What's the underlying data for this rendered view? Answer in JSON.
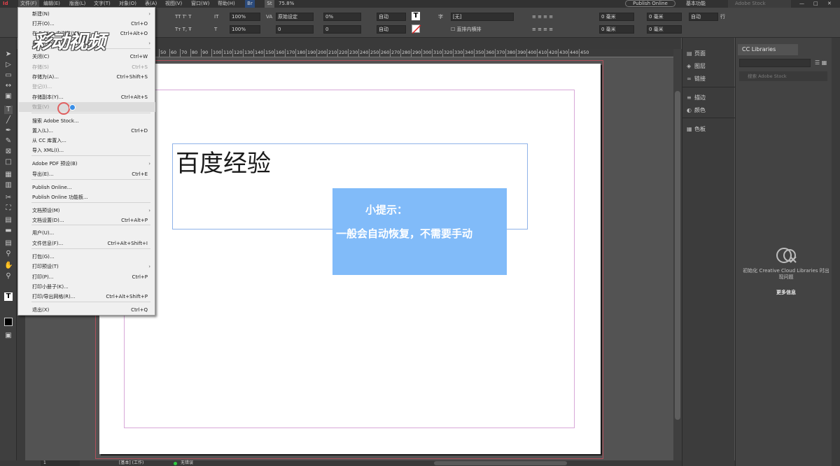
{
  "menubar": {
    "items": [
      "文件(F)",
      "编辑(E)",
      "版面(L)",
      "文字(T)",
      "对象(O)",
      "表(A)",
      "视图(V)",
      "窗口(W)",
      "帮助(H)"
    ],
    "br_badge": "Br",
    "st_badge": "St",
    "zoom": "75.8%",
    "publish_online": "Publish Online",
    "workspace": "基本功能",
    "search_placeholder": "Adobe Stock"
  },
  "controlbar": {
    "scale_h": "100%",
    "scale_v": "100%",
    "kerning": "原始设定",
    "tracking": "0%",
    "baseline": "0",
    "skew": "0",
    "auto1": "自动",
    "auto2": "自动",
    "language": "[无]",
    "no_hyphenation": "直排内横排",
    "space_before": "0 毫米",
    "space_after": "0 毫米",
    "space_before2": "0 毫米",
    "space_after2": "0 毫米",
    "auto3": "自动",
    "row": "行"
  },
  "ruler_ticks": [
    "50",
    "60",
    "70",
    "80",
    "90",
    "100",
    "110",
    "120",
    "130",
    "140",
    "150",
    "160",
    "170",
    "180",
    "190",
    "200",
    "210",
    "220",
    "230",
    "240",
    "250",
    "260",
    "270",
    "280",
    "290",
    "300",
    "310",
    "320",
    "330",
    "340",
    "350",
    "360",
    "370",
    "380",
    "390",
    "400",
    "410",
    "420",
    "430",
    "440",
    "450"
  ],
  "document": {
    "heading": "百度经验",
    "tip_title": "小提示：",
    "tip_body": "一般会自动恢复，不需要手动"
  },
  "watermark": "彩动视频",
  "file_menu": {
    "items": [
      {
        "label": "新建(N)",
        "shortcut": "",
        "submenu": true,
        "disabled": false
      },
      {
        "label": "打开(O)...",
        "shortcut": "Ctrl+O",
        "submenu": false,
        "disabled": false
      },
      {
        "label": "在 Bridge 中浏览(W)...",
        "shortcut": "Ctrl+Alt+O",
        "submenu": false,
        "disabled": false
      },
      {
        "label": "最近打开文件(R)",
        "shortcut": "",
        "submenu": true,
        "disabled": false
      },
      {
        "label": "关闭(C)",
        "shortcut": "Ctrl+W",
        "submenu": false,
        "disabled": false
      },
      {
        "label": "存储(S)",
        "shortcut": "Ctrl+S",
        "submenu": false,
        "disabled": true
      },
      {
        "label": "存储为(A)...",
        "shortcut": "Ctrl+Shift+S",
        "submenu": false,
        "disabled": false
      },
      {
        "label": "登记(I)...",
        "shortcut": "",
        "submenu": false,
        "disabled": true
      },
      {
        "label": "存储副本(Y)...",
        "shortcut": "Ctrl+Alt+S",
        "submenu": false,
        "disabled": false
      },
      {
        "label": "恢复(V)",
        "shortcut": "",
        "submenu": false,
        "disabled": true
      },
      {
        "label": "搜索 Adobe Stock...",
        "shortcut": "",
        "submenu": false,
        "disabled": false
      },
      {
        "label": "置入(L)...",
        "shortcut": "Ctrl+D",
        "submenu": false,
        "disabled": false
      },
      {
        "label": "从 CC 库置入...",
        "shortcut": "",
        "submenu": false,
        "disabled": false
      },
      {
        "label": "导入 XML(I)...",
        "shortcut": "",
        "submenu": false,
        "disabled": false
      },
      {
        "label": "Adobe PDF 预设(B)",
        "shortcut": "",
        "submenu": true,
        "disabled": false
      },
      {
        "label": "导出(E)...",
        "shortcut": "Ctrl+E",
        "submenu": false,
        "disabled": false
      },
      {
        "label": "Publish Online...",
        "shortcut": "",
        "submenu": false,
        "disabled": false
      },
      {
        "label": "Publish Online 功能板...",
        "shortcut": "",
        "submenu": false,
        "disabled": false
      },
      {
        "label": "文档预设(M)",
        "shortcut": "",
        "submenu": true,
        "disabled": false
      },
      {
        "label": "文档设置(D)...",
        "shortcut": "Ctrl+Alt+P",
        "submenu": false,
        "disabled": false
      },
      {
        "label": "用户(U)...",
        "shortcut": "",
        "submenu": false,
        "disabled": false
      },
      {
        "label": "文件信息(F)...",
        "shortcut": "Ctrl+Alt+Shift+I",
        "submenu": false,
        "disabled": false
      },
      {
        "label": "打包(G)...",
        "shortcut": "",
        "submenu": false,
        "disabled": false
      },
      {
        "label": "打印预设(T)",
        "shortcut": "",
        "submenu": true,
        "disabled": false
      },
      {
        "label": "打印(P)...",
        "shortcut": "Ctrl+P",
        "submenu": false,
        "disabled": false
      },
      {
        "label": "打印小册子(K)...",
        "shortcut": "",
        "submenu": false,
        "disabled": false
      },
      {
        "label": "打印/导出网格(R)...",
        "shortcut": "Ctrl+Alt+Shift+P",
        "submenu": false,
        "disabled": false
      },
      {
        "label": "退出(X)",
        "shortcut": "Ctrl+Q",
        "submenu": false,
        "disabled": false
      }
    ]
  },
  "panels": {
    "pages": "页面",
    "layers": "图层",
    "links": "链接",
    "stroke": "描边",
    "color": "颜色",
    "swatches": "色板",
    "cc_libraries_tab": "CC Libraries",
    "cc_search_placeholder": "搜索 Adobe Stock",
    "cc_message": "初始化 Creative Cloud Libraries 时出现问题",
    "cc_more_info": "更多信息"
  },
  "statusbar": {
    "page_number": "1",
    "basic": "[基本]",
    "work": "(工作)",
    "no_errors": "无错误"
  },
  "colors": {
    "tip_bg": "#81bbf9",
    "menu_bg": "#f0f0f0",
    "ui_dark": "#464646"
  }
}
